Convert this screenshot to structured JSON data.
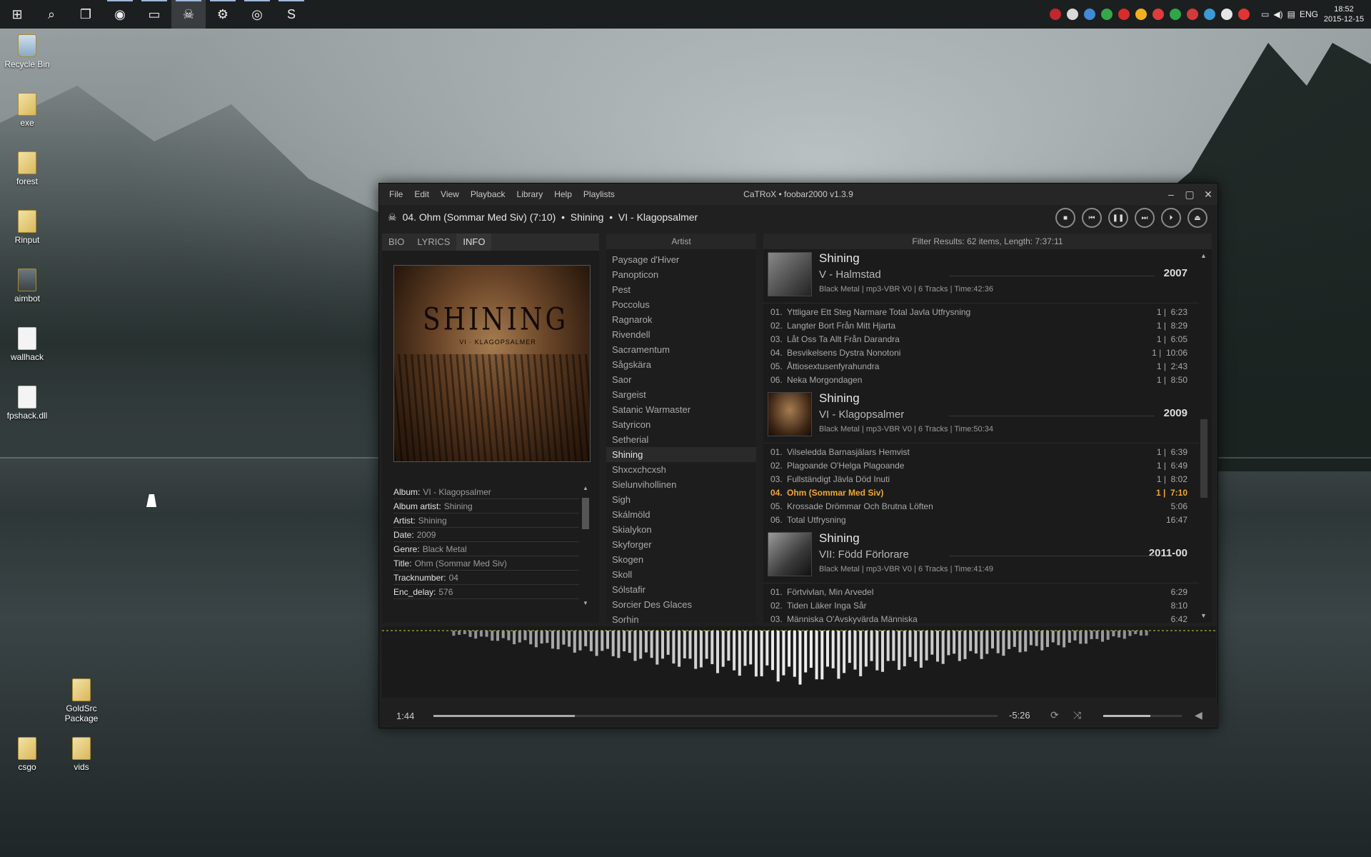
{
  "taskbar": {
    "apps": [
      {
        "name": "start-icon",
        "g": "⊞"
      },
      {
        "name": "search-icon",
        "g": "⌕"
      },
      {
        "name": "task-view-icon",
        "g": "❐"
      },
      {
        "name": "chrome-icon",
        "g": "◉"
      },
      {
        "name": "explorer-icon",
        "g": "▭"
      },
      {
        "name": "foobar-icon",
        "g": "☠"
      },
      {
        "name": "steam-icon",
        "g": "⚙"
      },
      {
        "name": "discord-icon",
        "g": "◎"
      },
      {
        "name": "skype-icon",
        "g": "S"
      }
    ],
    "lang": "ENG",
    "time": "18:52",
    "date": "2015-12-15",
    "tray_colors": [
      "#c0282c",
      "#d9d9d9",
      "#3e8bd6",
      "#37a84a",
      "#d82c2c",
      "#f0b020",
      "#e03c3c",
      "#2fa64a",
      "#d23b3b",
      "#3a9bd5",
      "#e6e6e6",
      "#e33434"
    ]
  },
  "desktop": {
    "icons": [
      {
        "label": "Recycle Bin",
        "kind": "bin"
      },
      {
        "label": "exe",
        "kind": "folder"
      },
      {
        "label": "forest",
        "kind": "folder"
      },
      {
        "label": "Rinput",
        "kind": "folder"
      },
      {
        "label": "aimbot",
        "kind": "pic"
      },
      {
        "label": "wallhack",
        "kind": "file"
      },
      {
        "label": "fpshack.dll",
        "kind": "file"
      },
      {
        "label": "GoldSrc Package",
        "kind": "folder"
      },
      {
        "label": "csgo",
        "kind": "folder"
      },
      {
        "label": "vids",
        "kind": "folder"
      }
    ]
  },
  "window": {
    "menu": [
      "File",
      "Edit",
      "View",
      "Playback",
      "Library",
      "Help",
      "Playlists"
    ],
    "title": "CaTRoX • foobar2000 v1.3.9",
    "now_playing": "04. Ohm (Sommar Med Siv) (7:10)  •  Shining  •  VI - Klagopsalmer",
    "tabs": [
      "BIO",
      "LYRICS",
      "INFO"
    ],
    "cover_band": "SHINING",
    "cover_sub": "VI · KLAGOPSALMER",
    "info": [
      {
        "k": "Album:",
        "v": "VI - Klagopsalmer"
      },
      {
        "k": "Album artist:",
        "v": "Shining"
      },
      {
        "k": "Artist:",
        "v": "Shining"
      },
      {
        "k": "Date:",
        "v": "2009"
      },
      {
        "k": "Genre:",
        "v": "Black Metal"
      },
      {
        "k": "Title:",
        "v": "Ohm (Sommar Med Siv)"
      },
      {
        "k": "Tracknumber:",
        "v": "04"
      },
      {
        "k": "Enc_delay:",
        "v": "576"
      }
    ],
    "artist_header": "Artist",
    "artists": [
      "Paysage d'Hiver",
      "Panopticon",
      "Pest",
      "Poccolus",
      "Ragnarok",
      "Rivendell",
      "Sacramentum",
      "Sågskära",
      "Saor",
      "Sargeist",
      "Satanic Warmaster",
      "Satyricon",
      "Setherial",
      "Shining",
      "Shxcxchcxsh",
      "Sielunvihollinen",
      "Sigh",
      "Skálmöld",
      "Skialykon",
      "Skyforger",
      "Skogen",
      "Skoll",
      "Sólstafir",
      "Sorcier Des Glaces",
      "Sorhin"
    ],
    "filter": "Filter Results: 62 items, Length: 7:37:11",
    "albums": [
      {
        "artist": "Shining",
        "album": "V - Halmstad",
        "year": "2007",
        "meta": "Black Metal | mp3-VBR V0 | 6 Tracks | Time:42:36",
        "tracks": [
          {
            "no": "01.",
            "t": "Yttligare Ett Steg Narmare Total Javla Utfrysning",
            "r": "1 |  6:23"
          },
          {
            "no": "02.",
            "t": "Langter Bort Från Mitt Hjarta",
            "r": "1 |  8:29"
          },
          {
            "no": "03.",
            "t": "Låt Oss Ta Allt Från Darandra",
            "r": "1 |  6:05"
          },
          {
            "no": "04.",
            "t": "Besvikelsens Dystra Nonotoni",
            "r": "1 |  10:06"
          },
          {
            "no": "05.",
            "t": "Åttiosextusenfyrahundra",
            "r": "1 |  2:43"
          },
          {
            "no": "06.",
            "t": "Neka Morgondagen",
            "r": "1 |  8:50"
          }
        ]
      },
      {
        "artist": "Shining",
        "album": "VI - Klagopsalmer",
        "year": "2009",
        "meta": "Black Metal | mp3-VBR V0 | 6 Tracks | Time:50:34",
        "tracks": [
          {
            "no": "01.",
            "t": "Vilseledda Barnasjälars Hemvist",
            "r": "1 |  6:39"
          },
          {
            "no": "02.",
            "t": "Plagoande O'Helga Plagoande",
            "r": "1 |  6:49"
          },
          {
            "no": "03.",
            "t": "Fullständigt Jävla Död Inuti",
            "r": "1 |  8:02"
          },
          {
            "no": "04.",
            "t": "Ohm (Sommar Med Siv)",
            "r": "1 |  7:10"
          },
          {
            "no": "05.",
            "t": "Krossade Drömmar Och Brutna Löften",
            "r": "5:06"
          },
          {
            "no": "06.",
            "t": "Total Utfrysning",
            "r": "16:47"
          }
        ]
      },
      {
        "artist": "Shining",
        "album": "VII: Född Förlorare",
        "year": "2011-00",
        "meta": "Black Metal | mp3-VBR V0 | 6 Tracks | Time:41:49",
        "tracks": [
          {
            "no": "01.",
            "t": "Förtvivlan, Min Arvedel",
            "r": "6:29"
          },
          {
            "no": "02.",
            "t": "Tiden Läker Inga Sår",
            "r": "8:10"
          },
          {
            "no": "03.",
            "t": "Människa O'Avskyvärda Människa",
            "r": "6:42"
          }
        ]
      }
    ],
    "elapsed": "1:44",
    "remaining": "-5:26",
    "progress": 0.25,
    "volume": 0.6,
    "accent": "#f0a832"
  }
}
